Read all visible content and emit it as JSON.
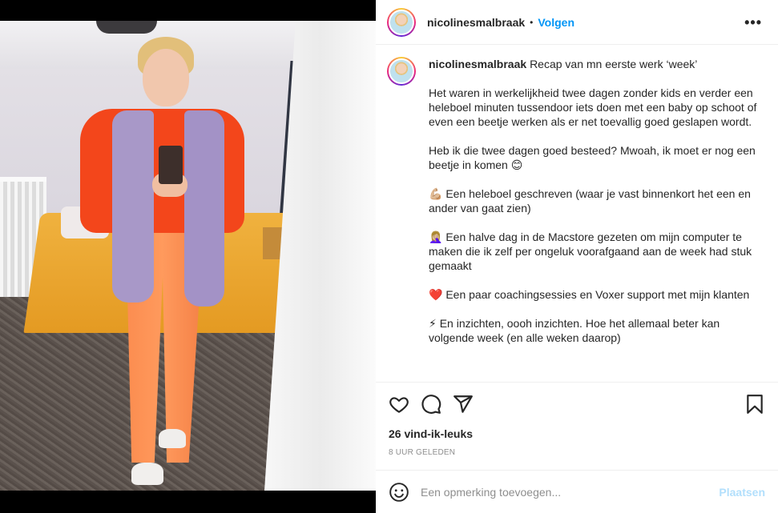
{
  "header": {
    "username": "nicolinesmalbraak",
    "separator": "•",
    "follow_label": "Volgen",
    "more_label": "•••"
  },
  "caption": {
    "username": "nicolinesmalbraak",
    "title_text": "Recap van mn eerste werk ‘week’",
    "paragraphs": [
      "Het waren in werkelijkheid twee dagen zonder kids en verder een heleboel minuten tussendoor iets doen met een baby op schoot of even een beetje werken als er net toevallig goed geslapen wordt.",
      "Heb ik die twee dagen goed besteed? Mwoah, ik moet er nog een beetje in komen 😊",
      "💪🏼 Een heleboel geschreven (waar je vast binnenkort het een en ander van gaat zien)",
      "🤦🏼‍♀️ Een halve dag in de Macstore gezeten om mijn computer te maken die ik zelf per ongeluk voorafgaand aan de week had stuk gemaakt",
      "❤️ Een paar coachingsessies en Voxer support met mijn klanten",
      "⚡ En inzichten, oooh inzichten. Hoe het allemaal beter kan volgende week (en alle weken daarop)"
    ]
  },
  "actions": {
    "icons": [
      "heart-icon",
      "comment-icon",
      "share-icon",
      "bookmark-icon"
    ],
    "likes_text": "26 vind-ik-leuks",
    "time_text": "8 UUR GELEDEN"
  },
  "comment": {
    "placeholder": "Een opmerking toevoegen...",
    "post_label": "Plaatsen"
  },
  "colors": {
    "link_blue": "#0095f6",
    "post_disabled": "#b2dffc",
    "muted": "#8e8e8e"
  }
}
